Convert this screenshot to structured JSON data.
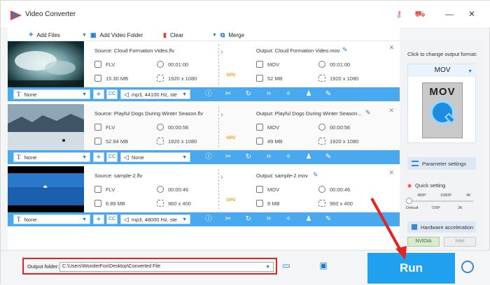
{
  "app": {
    "title": "Video Converter"
  },
  "toolbar": {
    "add_files": "Add Files",
    "add_folder": "Add Video Folder",
    "clear": "Clear",
    "merge": "Merge"
  },
  "items": [
    {
      "source": "Source: Cloud Formation Video.flv",
      "src_format": "FLV",
      "src_duration": "00:01:00",
      "src_size": "15.30 MB",
      "src_res": "1920 x 1080",
      "gpu": "GPU",
      "output": "Output: Cloud Formation Video.mov",
      "out_format": "MOV",
      "out_duration": "00:01:00",
      "out_size": "52 MB",
      "out_res": "1920 x 1080",
      "subtitle": "None",
      "audio": "mp3, 44100 Hz, ste"
    },
    {
      "source": "Source: Playful Dogs During Winter Season.flv",
      "src_format": "FLV",
      "src_duration": "00:00:56",
      "src_size": "52.94 MB",
      "src_res": "1920 x 1080",
      "gpu": "GPU",
      "output": "Output: Playful Dogs During Winter Season...",
      "out_format": "MOV",
      "out_duration": "00:00:56",
      "out_size": "49 MB",
      "out_res": "1920 x 1080",
      "subtitle": "None",
      "audio": "None"
    },
    {
      "source": "Source: sample-2.flv",
      "src_format": "FLV",
      "src_duration": "00:00:46",
      "src_size": "6.89 MB",
      "src_res": "960 x 400",
      "gpu": "GPU",
      "output": "Output: sample-2.mov",
      "out_format": "MOV",
      "out_duration": "00:00:46",
      "out_size": "8 MB",
      "out_res": "960 x 400",
      "subtitle": "None",
      "audio": "mp3, 48000 Hz, ste"
    }
  ],
  "right_panel": {
    "click_label": "Click to change output format:",
    "format": "MOV",
    "format_icon_text": "MOV",
    "parameter_settings": "Parameter settings",
    "quick_setting": "Quick setting",
    "res_top": [
      "480P",
      "1080P",
      "4K"
    ],
    "res_bottom": [
      "Default",
      "720P",
      "2K"
    ],
    "quick_setting_level": 0,
    "hardware_acceleration": "Hardware acceleration",
    "nvidia": "NVIDIA",
    "intel": "Intel"
  },
  "bottom": {
    "output_folder_label": "Output folder:",
    "output_path": "C:\\Users\\WonderFox\\Desktop\\Converted File",
    "run": "Run"
  },
  "colors": {
    "accent": "#1fa1f0",
    "highlight": "#e42323",
    "gpu": "#e29b1a"
  }
}
